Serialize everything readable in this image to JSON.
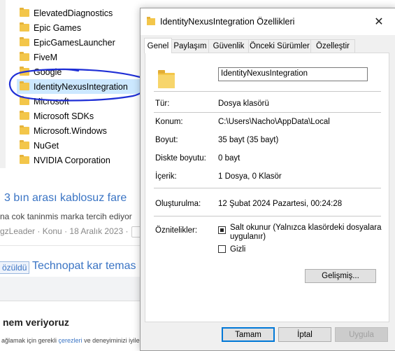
{
  "explorer": {
    "items": [
      {
        "label": "ElevatedDiagnostics"
      },
      {
        "label": "Epic Games"
      },
      {
        "label": "EpicGamesLauncher"
      },
      {
        "label": "FiveM"
      },
      {
        "label": "Google"
      },
      {
        "label": "IdentityNexusIntegration",
        "selected": true
      },
      {
        "label": "Microsoft"
      },
      {
        "label": "Microsoft SDKs"
      },
      {
        "label": "Microsoft.Windows"
      },
      {
        "label": "NuGet"
      },
      {
        "label": "NVIDIA Corporation"
      }
    ],
    "annotation_color": "#1f2fd6"
  },
  "forum": {
    "title1": "3 bın arası kablosuz fare",
    "snippet": "na cok taninmis marka tercih ediyor",
    "meta": "gzLeader · Konu · 18 Aralık 2023 ·",
    "badge": "özüldü",
    "title2": "Technopat kar temas",
    "cookie_title": "nem veriyoruz",
    "cookie_text_pre": "ağlamak için gerekli ",
    "cookie_link": "çerezleri",
    "cookie_text_post": " ve deneyiminizi iyile"
  },
  "dialog": {
    "title": "IdentityNexusIntegration Özellikleri",
    "close_glyph": "✕",
    "tabs": [
      {
        "label": "Genel",
        "active": true
      },
      {
        "label": "Paylaşım"
      },
      {
        "label": "Güvenlik"
      },
      {
        "label": "Önceki Sürümler"
      },
      {
        "label": "Özelleştir"
      }
    ],
    "name_value": "IdentityNexusIntegration",
    "props": {
      "type_label": "Tür:",
      "type_value": "Dosya klasörü",
      "location_label": "Konum:",
      "location_value": "C:\\Users\\Nacho\\AppData\\Local",
      "size_label": "Boyut:",
      "size_value": "35 bayt (35 bayt)",
      "disk_label": "Diskte boyutu:",
      "disk_value": "0 bayt",
      "contents_label": "İçerik:",
      "contents_value": "1 Dosya, 0 Klasör",
      "created_label": "Oluşturulma:",
      "created_value": "12 Şubat 2024 Pazartesi, 00:24:28",
      "attributes_label": "Öznitelikler:"
    },
    "attributes": {
      "readonly_label": "Salt okunur (Yalnızca klasördeki dosyalara uygulanır)",
      "readonly_checked": true,
      "hidden_label": "Gizli",
      "hidden_checked": false,
      "advanced_button": "Gelişmiş..."
    },
    "buttons": {
      "ok": "Tamam",
      "cancel": "İptal",
      "apply": "Uygula"
    }
  }
}
